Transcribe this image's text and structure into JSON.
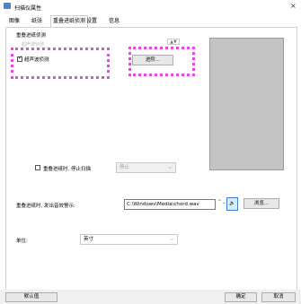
{
  "window": {
    "title": "扫描仪属性",
    "close": "×"
  },
  "tabs": [
    "图像",
    "纸张",
    "重叠进纸侦测",
    "设置",
    "信息"
  ],
  "group": {
    "label": "重叠进纸侦测"
  },
  "ultrasonic": {
    "label": "超声波侦测",
    "faint_caption": "超声波侦测",
    "checked": true
  },
  "advanced_button": "进阶...",
  "stop_scan": {
    "label": "重叠进纸时, 停止扫描",
    "checked": false,
    "mode": "停止"
  },
  "sound": {
    "label": "重叠进纸时, 发出音效警示:",
    "path": "C:\\Windows\\Media\\chord.wav",
    "browse": "浏览..."
  },
  "unit": {
    "label": "单位:",
    "value": "英寸"
  },
  "footer": {
    "default": "默认值",
    "ok": "确定",
    "cancel": "取消"
  },
  "colors": {
    "highlight": "#e14be0",
    "preview": "#c4c4c4"
  },
  "icons": [
    "app-icon",
    "speaker-icon",
    "spin-icon",
    "chevron-down-icon"
  ]
}
